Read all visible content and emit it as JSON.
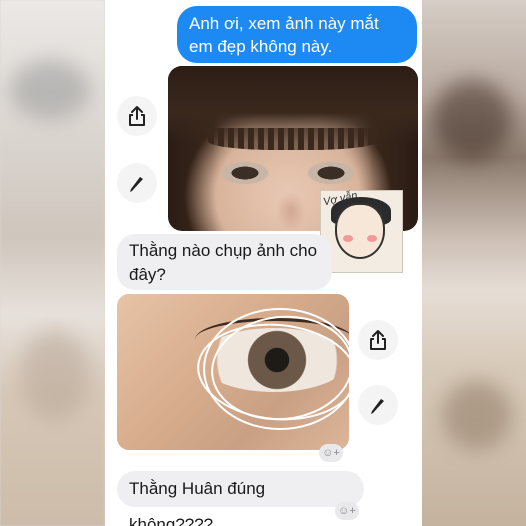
{
  "messages": {
    "outgoing_1": "Anh ơi, xem ảnh này mắt em đẹp không này.",
    "incoming_1": "Thằng nào chụp ảnh cho đây?",
    "incoming_2": "Thằng Huân đúng không????"
  },
  "sticker": {
    "text": "Vợ vẫn"
  },
  "icons": {
    "share": "share-icon",
    "edit": "pencil-icon",
    "react": "add-reaction-icon"
  },
  "colors": {
    "outgoing_bubble": "#1d8af3",
    "incoming_bubble": "#efeff1",
    "chat_background": "#ffffff"
  }
}
